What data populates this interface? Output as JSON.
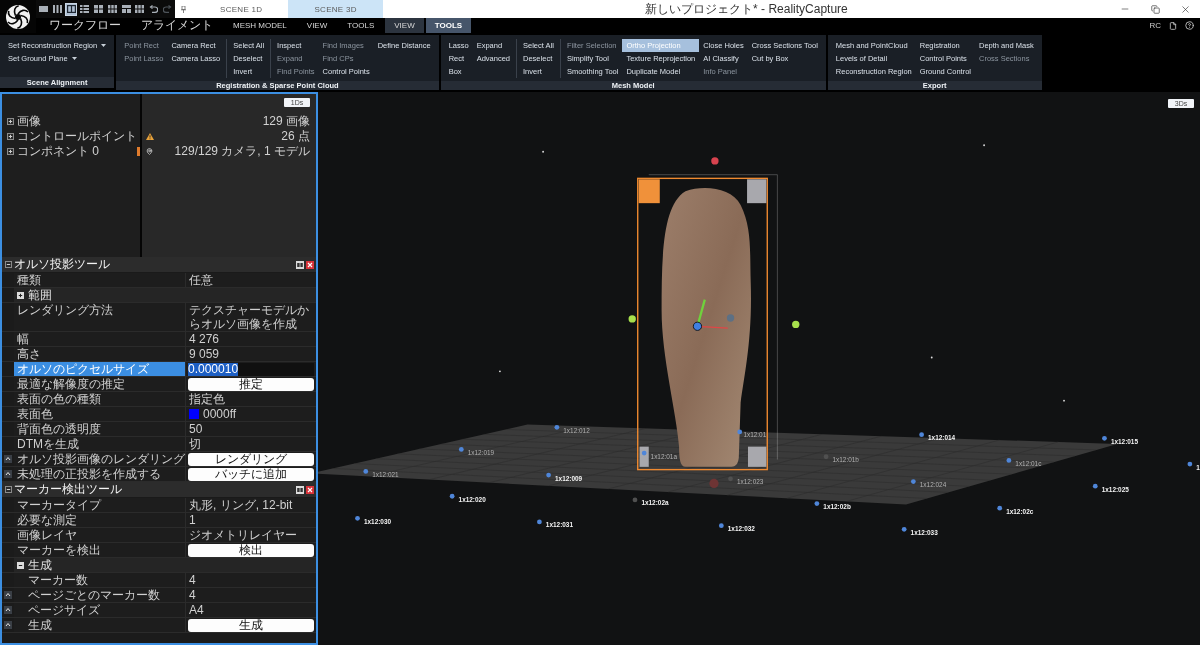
{
  "title_bar": {
    "layouts": [
      {
        "kind": "single",
        "selected": false
      },
      {
        "kind": "columns",
        "selected": false
      },
      {
        "kind": "split",
        "selected": true
      },
      {
        "kind": "rows",
        "selected": false
      },
      {
        "kind": "quad",
        "selected": false
      },
      {
        "kind": "grid",
        "selected": false
      },
      {
        "kind": "tee",
        "selected": false
      },
      {
        "kind": "grid",
        "selected": false
      }
    ],
    "history": [
      {
        "kind": "undo",
        "disabled": false
      },
      {
        "kind": "redo",
        "disabled": true
      }
    ],
    "tabs": [
      {
        "label": "SCENE 1D",
        "selected": false
      },
      {
        "label": "SCENE 3D",
        "selected": true
      }
    ],
    "title": "新しいプロジェクト* - RealityCapture"
  },
  "menu": {
    "tabs": [
      {
        "label": "ワークフロー",
        "selected": false,
        "contextual": false
      },
      {
        "label": "アライメント",
        "selected": false,
        "contextual": false
      },
      {
        "label": "MESH MODEL",
        "selected": false,
        "contextual": false
      },
      {
        "label": "VIEW",
        "selected": false,
        "contextual": false
      },
      {
        "label": "TOOLS",
        "selected": false,
        "contextual": false
      },
      {
        "label": "VIEW",
        "selected": false,
        "contextual": true
      },
      {
        "label": "TOOLS",
        "selected": true,
        "contextual": true
      }
    ],
    "user": "RC"
  },
  "ribbon": [
    {
      "title": "Scene Alignment",
      "sections": [
        {
          "columns": [
            [
              {
                "label": "Set Reconstruction Region",
                "dropdown": true,
                "disabled": false,
                "active": false
              },
              {
                "label": "Set Ground Plane",
                "dropdown": true,
                "disabled": false,
                "active": false
              }
            ]
          ]
        }
      ]
    },
    {
      "title": "Registration & Sparse Point Cloud",
      "sections": [
        {
          "columns": [
            [
              {
                "label": "Point Rect",
                "disabled": true,
                "active": false
              },
              {
                "label": "Point Lasso",
                "disabled": true,
                "active": false
              }
            ],
            [
              {
                "label": "Camera Rect",
                "disabled": false,
                "active": false
              },
              {
                "label": "Camera Lasso",
                "disabled": false,
                "active": false
              }
            ]
          ]
        },
        {
          "columns": [
            [
              {
                "label": "Select All",
                "disabled": false,
                "active": false
              },
              {
                "label": "Deselect",
                "disabled": false,
                "active": false
              },
              {
                "label": "Invert",
                "disabled": false,
                "active": false
              }
            ]
          ]
        },
        {
          "columns": [
            [
              {
                "label": "Inspect",
                "disabled": false,
                "active": false
              },
              {
                "label": "Expand",
                "disabled": true,
                "active": false
              },
              {
                "label": "Find Points",
                "disabled": true,
                "active": false
              }
            ],
            [
              {
                "label": "Find Images",
                "disabled": true,
                "active": false
              },
              {
                "label": "Find CPs",
                "disabled": true,
                "active": false
              },
              {
                "label": "Control Points",
                "disabled": false,
                "active": false
              }
            ],
            [
              {
                "label": "Define Distance",
                "disabled": false,
                "active": false
              }
            ]
          ]
        }
      ]
    },
    {
      "title": "Mesh Model",
      "sections": [
        {
          "columns": [
            [
              {
                "label": "Lasso",
                "disabled": false,
                "active": false
              },
              {
                "label": "Rect",
                "disabled": false,
                "active": false
              },
              {
                "label": "Box",
                "disabled": false,
                "active": false
              }
            ],
            [
              {
                "label": "Expand",
                "disabled": false,
                "active": false
              },
              {
                "label": "Advanced",
                "disabled": false,
                "active": false
              }
            ]
          ]
        },
        {
          "columns": [
            [
              {
                "label": "Select All",
                "disabled": false,
                "active": false
              },
              {
                "label": "Deselect",
                "disabled": false,
                "active": false
              },
              {
                "label": "Invert",
                "disabled": false,
                "active": false
              }
            ]
          ]
        },
        {
          "columns": [
            [
              {
                "label": "Filter Selection",
                "disabled": true,
                "active": false
              },
              {
                "label": "Simplify Tool",
                "disabled": false,
                "active": false
              },
              {
                "label": "Smoothing Tool",
                "disabled": false,
                "active": false
              }
            ],
            [
              {
                "label": "Ortho Projection",
                "disabled": false,
                "active": true
              },
              {
                "label": "Texture Reprojection",
                "disabled": false,
                "active": false
              },
              {
                "label": "Duplicate Model",
                "disabled": false,
                "active": false
              }
            ],
            [
              {
                "label": "Close Holes",
                "disabled": false,
                "active": false
              },
              {
                "label": "AI Classify",
                "disabled": false,
                "active": false
              },
              {
                "label": "Info Panel",
                "disabled": true,
                "active": false
              }
            ],
            [
              {
                "label": "Cross Sections Tool",
                "disabled": false,
                "active": false
              },
              {
                "label": "Cut by Box",
                "disabled": false,
                "active": false
              }
            ]
          ]
        }
      ]
    },
    {
      "title": "Export",
      "sections": [
        {
          "columns": [
            [
              {
                "label": "Mesh and PointCloud",
                "disabled": false,
                "active": false
              },
              {
                "label": "Levels of Detail",
                "disabled": false,
                "active": false
              },
              {
                "label": "Reconstruction Region",
                "disabled": false,
                "active": false
              }
            ],
            [
              {
                "label": "Registration",
                "disabled": false,
                "active": false
              },
              {
                "label": "Control Points",
                "disabled": false,
                "active": false
              },
              {
                "label": "Ground Control",
                "disabled": false,
                "active": false
              }
            ],
            [
              {
                "label": "Depth and Mask",
                "disabled": false,
                "active": false
              },
              {
                "label": "Cross Sections",
                "disabled": true,
                "active": false
              }
            ]
          ]
        }
      ]
    }
  ],
  "project_tree": {
    "button": "1Ds",
    "items": [
      {
        "kind": "plain",
        "label": "画像",
        "value": "129 画像",
        "expanded": false,
        "highlighted": false
      },
      {
        "kind": "warning",
        "label": "コントロールポイント",
        "value": "26 点",
        "expanded": false,
        "highlighted": false
      },
      {
        "kind": "pin",
        "label": "コンポネント 0",
        "value": "129/129 カメラ, 1 モデル",
        "expanded": false,
        "highlighted": true
      }
    ]
  },
  "ortho_tool": {
    "title": "オルソ投影ツール",
    "expanded": true,
    "rows": [
      {
        "kind": "text",
        "label": "種類",
        "value": "任意",
        "selected": false
      },
      {
        "kind": "section",
        "label": "範囲",
        "expanded": false,
        "selected": false
      },
      {
        "kind": "text",
        "label": "レンダリング方法",
        "value": "テクスチャーモデルからオルソ画像を作成",
        "selected": false
      },
      {
        "kind": "text",
        "label": "幅",
        "value": "4 276",
        "selected": false
      },
      {
        "kind": "text",
        "label": "高さ",
        "value": "9 059",
        "selected": false
      },
      {
        "kind": "edit",
        "label": "オルソのピクセルサイズ",
        "value": "0.000010",
        "selected": true
      },
      {
        "kind": "button",
        "label": "最適な解像度の推定",
        "value": "推定",
        "selected": false
      },
      {
        "kind": "text",
        "label": "表面の色の種類",
        "value": "指定色",
        "selected": false
      },
      {
        "kind": "color",
        "label": "表面色",
        "value": "0000ff",
        "color": "#0000ff",
        "selected": false
      },
      {
        "kind": "text",
        "label": "背面色の透明度",
        "value": "50",
        "selected": false
      },
      {
        "kind": "text",
        "label": "DTMを生成",
        "value": "切",
        "selected": false
      },
      {
        "kind": "button",
        "label": "オルソ投影画像のレンダリング",
        "value": "レンダリング",
        "selected": false
      },
      {
        "kind": "button",
        "label": "未処理の正投影を作成する",
        "value": "バッチに追加",
        "selected": false
      }
    ]
  },
  "marker_tool": {
    "title": "マーカー検出ツール",
    "expanded": true,
    "rows": [
      {
        "kind": "text",
        "label": "マーカータイプ",
        "value": "丸形, リング, 12-bit",
        "selected": false
      },
      {
        "kind": "text",
        "label": "必要な測定",
        "value": "1",
        "selected": false
      },
      {
        "kind": "text",
        "label": "画像レイヤ",
        "value": "ジオメトリレイヤー",
        "selected": false
      },
      {
        "kind": "button",
        "label": "マーカーを検出",
        "value": "検出",
        "selected": false
      },
      {
        "kind": "section",
        "label": "生成",
        "expanded": true,
        "selected": false,
        "children": [
          {
            "kind": "text",
            "label": "マーカー数",
            "value": "4",
            "selected": false
          },
          {
            "kind": "text",
            "label": "ページごとのマーカー数",
            "value": "4",
            "selected": false
          },
          {
            "kind": "text",
            "label": "ページサイズ",
            "value": "A4",
            "selected": false
          },
          {
            "kind": "button",
            "label": "生成",
            "value": "生成",
            "selected": false
          }
        ]
      }
    ]
  },
  "viewport": {
    "button": "3Ds",
    "markers": [
      {
        "label": "1x12:012",
        "faded": true,
        "color": "#4f86d9"
      },
      {
        "label": "1x12:014",
        "faded": false,
        "color": "#4f86d9"
      },
      {
        "label": "1x12:01",
        "faded": true,
        "color": "#4f86d9"
      },
      {
        "label": "1x12:015",
        "faded": false,
        "color": "#4f86d9"
      },
      {
        "label": "1x12:019",
        "faded": true,
        "color": "#4f86d9"
      },
      {
        "label": "1x12:01a",
        "faded": true,
        "color": "#4f86d9"
      },
      {
        "label": "1x12:01b",
        "faded": true,
        "color": "#505050"
      },
      {
        "label": "1x12:01c",
        "faded": true,
        "color": "#4f86d9"
      },
      {
        "label": "1",
        "faded": false,
        "color": "#4f86d9"
      },
      {
        "label": "1x12:021",
        "faded": true,
        "color": "#4f86d9"
      },
      {
        "label": "1x12:009",
        "faded": false,
        "color": "#4f86d9"
      },
      {
        "label": "1x12:023",
        "faded": true,
        "color": "#505050"
      },
      {
        "label": "1x12:024",
        "faded": true,
        "color": "#4f86d9"
      },
      {
        "label": "1x12:025",
        "faded": false,
        "color": "#4f86d9"
      },
      {
        "label": "1x12:020",
        "faded": false,
        "color": "#4f86d9"
      },
      {
        "label": "1x12:02a",
        "faded": false,
        "color": "#505050"
      },
      {
        "label": "1x12:02b",
        "faded": false,
        "color": "#4f86d9"
      },
      {
        "label": "1x12:02c",
        "faded": false,
        "color": "#4f86d9"
      },
      {
        "label": "1x12:030",
        "faded": false,
        "color": "#4f86d9"
      },
      {
        "label": "1x12:031",
        "faded": false,
        "color": "#4f86d9"
      },
      {
        "label": "1x12:032",
        "faded": false,
        "color": "#4f86d9"
      },
      {
        "label": "1x12:033",
        "faded": false,
        "color": "#4f86d9"
      }
    ]
  }
}
